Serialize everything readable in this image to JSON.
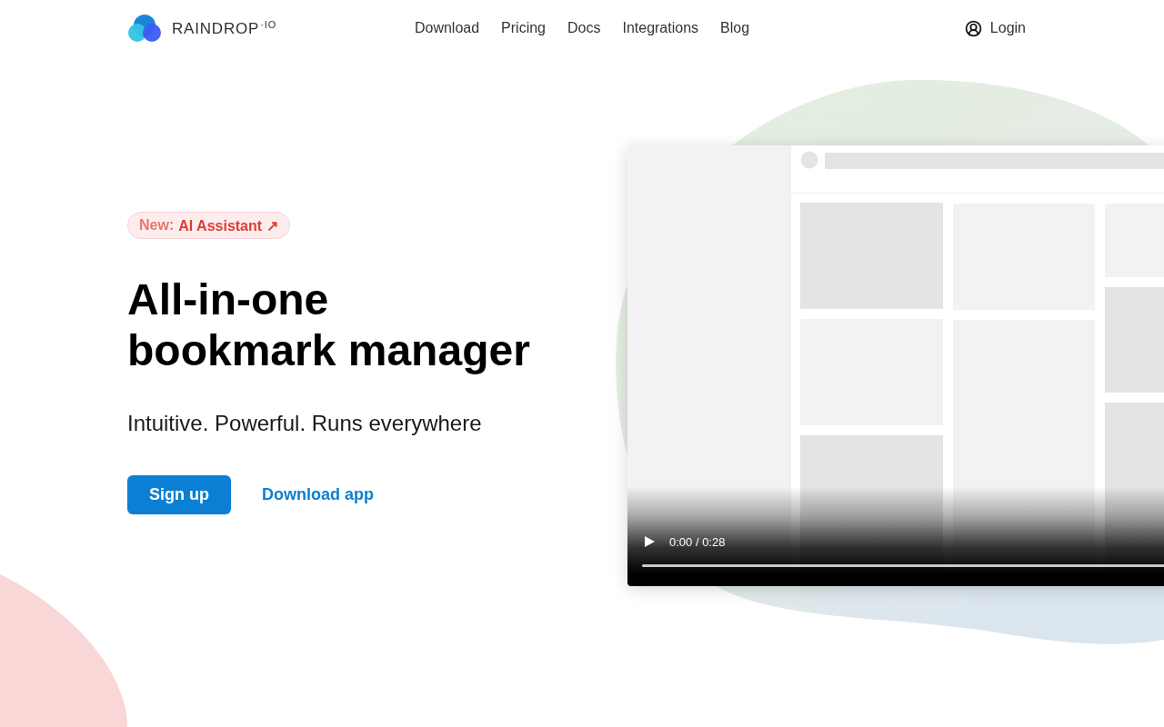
{
  "header": {
    "logo": {
      "text": "RAINDROP$^{·IO}$"
    },
    "nav": [
      "Download",
      "Pricing",
      "Docs",
      "Integrations",
      "Blog"
    ],
    "login": {
      "label": "Login"
    }
  },
  "hero": {
    "badge": {
      "prefix": "New:",
      "label": "AI Assistant ↗"
    },
    "title": "All-in-one bookmark manager",
    "subtitle": "Intuitive. Powerful. Runs everywhere",
    "actions": [
      {
        "kind": "primary",
        "label": "Sign up"
      },
      {
        "kind": "link",
        "label": "Download app"
      }
    ]
  },
  "video": {
    "playing": false,
    "time": "0:00 / 0:28"
  }
}
